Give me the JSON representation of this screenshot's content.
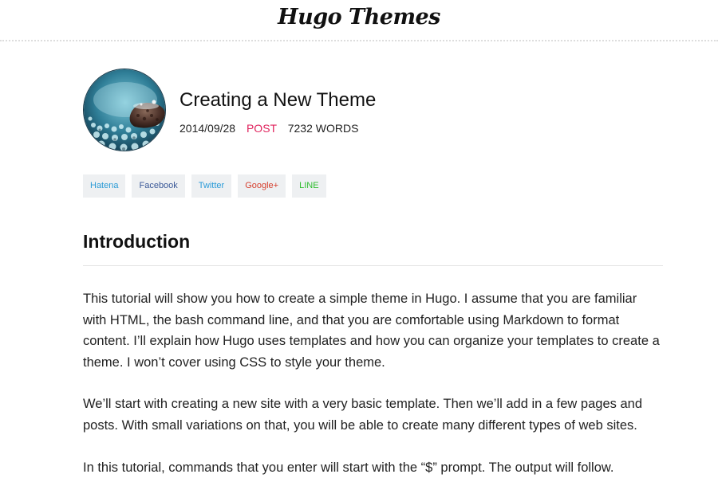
{
  "site": {
    "title": "Hugo Themes"
  },
  "post": {
    "title": "Creating a New Theme",
    "date": "2014/09/28",
    "category": "POST",
    "word_count": "7232 WORDS",
    "thumbnail_icon": "water-droplet-photo"
  },
  "share": {
    "hatena": "Hatena",
    "facebook": "Facebook",
    "twitter": "Twitter",
    "google": "Google+",
    "line": "LINE"
  },
  "content": {
    "heading": "Introduction",
    "paragraphs": [
      "This tutorial will show you how to create a simple theme in Hugo. I assume that you are familiar with HTML, the bash command line, and that you are comfortable using Markdown to format content. I’ll explain how Hugo uses templates and how you can organize your templates to create a theme. I won’t cover using CSS to style your theme.",
      "We’ll start with creating a new site with a very basic template. Then we’ll add in a few pages and posts. With small variations on that, you will be able to create many different types of web sites.",
      "In this tutorial, commands that you enter will start with the “$” prompt. The output will follow."
    ]
  },
  "colors": {
    "category": "#e0245e",
    "hatena": "#2c9bd6",
    "facebook": "#3b5998",
    "twitter": "#2a9bd8",
    "google": "#d6402f",
    "line": "#2fbd2f"
  }
}
